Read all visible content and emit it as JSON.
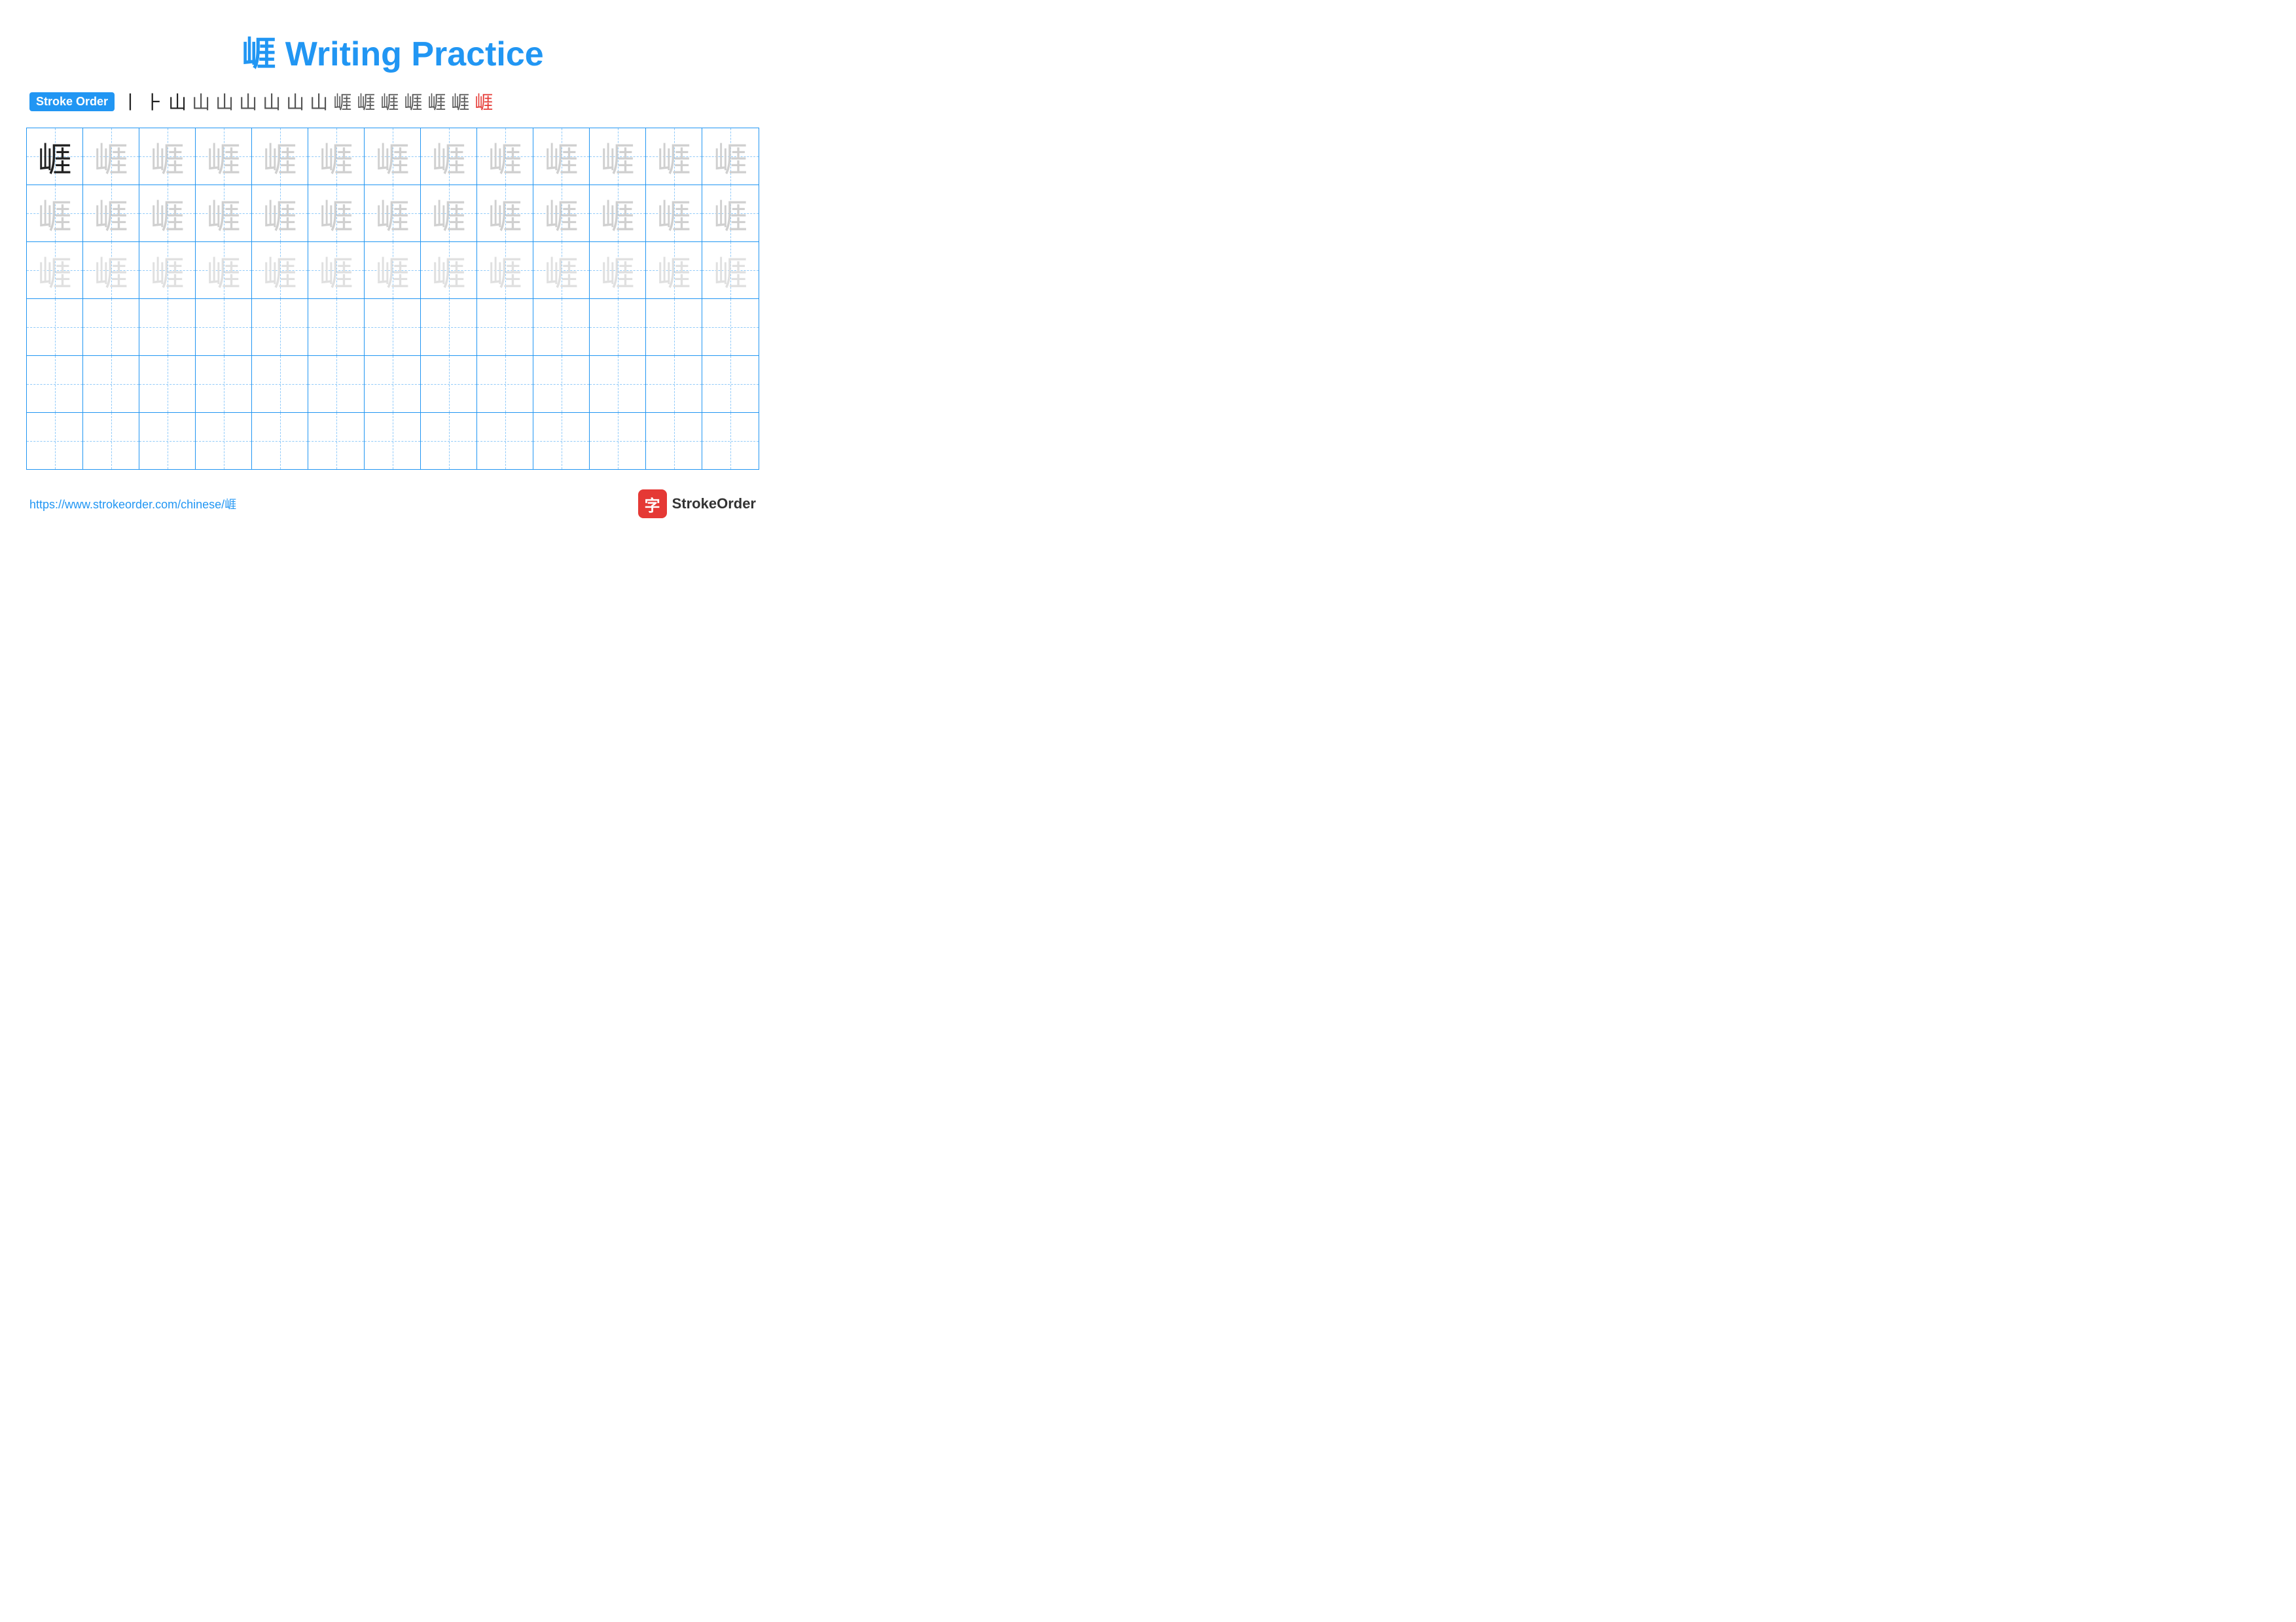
{
  "page": {
    "title": "崕 Writing Practice",
    "character": "崕",
    "stroke_order_label": "Stroke Order",
    "stroke_sequence": [
      "丨",
      "⊥",
      "山",
      "山",
      "山⌐",
      "山⌐⌐",
      "山⌐⌐⌐",
      "山⌐⌐⌐⌐",
      "山⌐⌐⌐⌐⌐",
      "崕⁻",
      "崕⁻⁻",
      "崕⁻⁻⁻",
      "崕⁻⁻⁻⁻",
      "崕⁻⁻⁻⁻⁻",
      "崕⁻⁻⁻⁻⁻⁻",
      "崕"
    ],
    "footer_url": "https://www.strokeorder.com/chinese/崕",
    "footer_logo_text": "StrokeOrder",
    "footer_logo_char": "字"
  },
  "grid": {
    "rows": 6,
    "cols": 13,
    "char": "崕"
  }
}
